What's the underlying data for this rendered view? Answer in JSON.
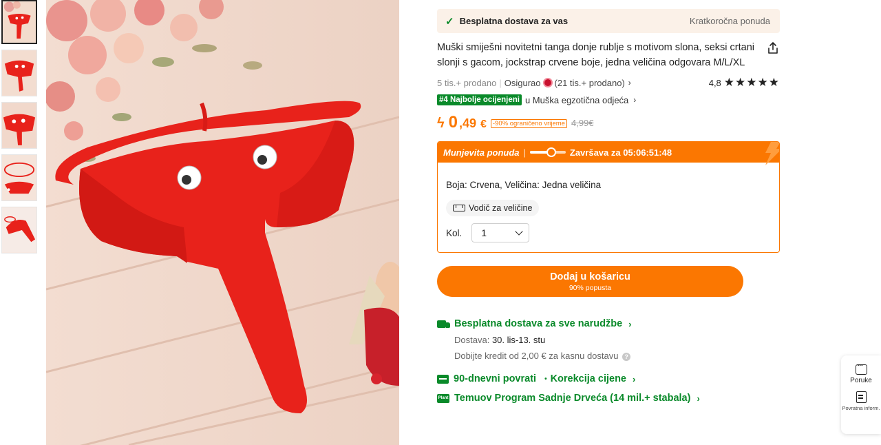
{
  "gallery": {
    "thumbnails": [
      "thumb-1",
      "thumb-2",
      "thumb-3",
      "thumb-4",
      "thumb-5"
    ],
    "active_index": 0
  },
  "promo_bar": {
    "icon": "check-icon",
    "label": "Besplatna dostava za vas",
    "right_label": "Kratkoročna ponuda"
  },
  "product": {
    "title": "Muški smiješni novitetni tanga donje rublje s motivom slona, seksi crtani slonji s gacom, jockstrap crvene boje, jedna veličina odgovara M/L/XL",
    "sold": "5 tis.+ prodano",
    "insured_label": "Osigurao",
    "insured_sold": "(21 tis.+ prodano)",
    "rating": "4,8",
    "stars": "★★★★★",
    "rank_badge": "#4 Najbolje ocijenjeni",
    "rank_category": "u Muška egzotična odjeća"
  },
  "price": {
    "main": "0",
    "decimal": ",49",
    "currency": "€",
    "discount_tag": "-90% ograničeno vrijeme",
    "old_price": "4,99€"
  },
  "deal": {
    "label": "Munjevita ponuda",
    "timer_fraction": 0.6,
    "ends_label": "Završava za 05:06:51:48",
    "variant": "Boja: Crvena, Veličina: Jedna veličina",
    "size_guide": "Vodič za veličine",
    "qty_label": "Kol.",
    "qty_value": "1"
  },
  "cart": {
    "label": "Dodaj u košaricu",
    "sub_label": "90% popusta"
  },
  "shipping": {
    "free_label": "Besplatna dostava za sve narudžbe",
    "delivery_prefix": "Dostava:",
    "delivery_value": "30. lis-13. stu",
    "credit_text": "Dobijte kredit od 2,00 € za kasnu dostavu",
    "returns": "90-dnevni povrati",
    "price_adjust": "Korekcija cijene",
    "program": "Temuov Program Sadnje Drveća (14 mil.+ stabala)",
    "plant_icon_text": "Plant"
  },
  "side_widget": {
    "messages": "Poruke",
    "feedback": "Povratna inform."
  },
  "colors": {
    "accent": "#fb7701",
    "green": "#0a8a2a",
    "product_red": "#e8221b"
  }
}
